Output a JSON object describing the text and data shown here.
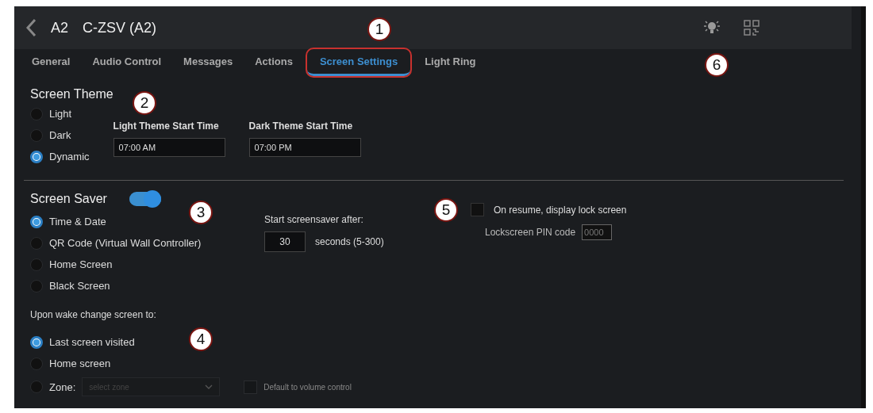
{
  "header": {
    "code": "A2",
    "title": "C-ZSV (A2)"
  },
  "tabs": [
    {
      "label": "General",
      "selected": false,
      "outlined": false
    },
    {
      "label": "Audio Control",
      "selected": false,
      "outlined": false
    },
    {
      "label": "Messages",
      "selected": false,
      "outlined": false
    },
    {
      "label": "Actions",
      "selected": false,
      "outlined": false
    },
    {
      "label": "Screen Settings",
      "selected": true,
      "outlined": true
    },
    {
      "label": "Light Ring",
      "selected": false,
      "outlined": false
    }
  ],
  "screen_theme": {
    "title": "Screen Theme",
    "options": [
      {
        "label": "Light",
        "selected": false
      },
      {
        "label": "Dark",
        "selected": false
      },
      {
        "label": "Dynamic",
        "selected": true
      }
    ],
    "fields": [
      {
        "label": "Light Theme Start Time",
        "value": "07:00 AM"
      },
      {
        "label": "Dark Theme Start Time",
        "value": "07:00 PM"
      }
    ]
  },
  "screen_saver": {
    "title": "Screen Saver",
    "on": true,
    "options": [
      {
        "label": "Time & Date",
        "selected": true
      },
      {
        "label": "QR Code (Virtual Wall Controller)",
        "selected": false
      },
      {
        "label": "Home Screen",
        "selected": false
      },
      {
        "label": "Black Screen",
        "selected": false
      }
    ],
    "delay": {
      "label": "Start screensaver after:",
      "value": "30",
      "unit": "seconds (5-300)"
    },
    "lock": {
      "label": "On resume, display lock screen",
      "checked": false,
      "pin_label": "Lockscreen PIN code",
      "pin_placeholder": "0000"
    }
  },
  "wake": {
    "label": "Upon wake change screen to:",
    "options": [
      {
        "label": "Last screen visited",
        "selected": true,
        "kind": "plain"
      },
      {
        "label": "Home screen",
        "selected": false,
        "kind": "plain"
      },
      {
        "label": "Zone:",
        "selected": false,
        "kind": "zone"
      }
    ],
    "zone_placeholder": "select zone",
    "default_volume": {
      "label": "Default to volume control",
      "checked": false
    }
  },
  "callouts": [
    "1",
    "2",
    "3",
    "4",
    "5",
    "6"
  ]
}
